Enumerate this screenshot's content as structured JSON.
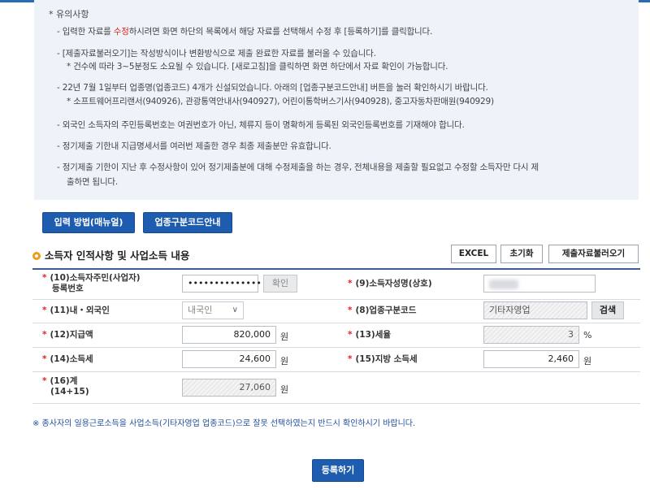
{
  "notice": {
    "title": "* 유의사항",
    "lines": [
      {
        "pre": "- 입력한 자료를 ",
        "red": "수정",
        "post": "하시려면 화면 하단의 목록에서 해당 자료를 선택해서 수정 후 [등록하기]를 클릭합니다."
      },
      {
        "text": "- [제출자료불러오기]는 작성방식이나 변환방식으로 제출 완료한 자료를 불러올 수 있습니다."
      },
      {
        "text": "* 건수에 따라 3~5분정도 소요될 수 있습니다. [새로고침]을 클릭하면 화면 하단에서 자료 확인이 가능합니다."
      },
      {
        "text": "- 22년 7월 1일부터 업종명(업종코드) 4개가 신설되었습니다. 아래의 [업종구분코드안내] 버튼을 눌러 확인하시기 바랍니다."
      },
      {
        "text": "* 소프트웨어프리랜서(940926), 관광통역안내사(940927), 어린이통학버스기사(940928), 중고자동차판매원(940929)"
      },
      {
        "text": "- 외국인 소득자의 주민등록번호는 여권번호가 아닌, 체류지 등이 명확하게 등록된 외국인등록번호를 기재해야 합니다."
      },
      {
        "text": "- 정기제출 기한내 지급명세서를 여러번 제출한 경우 최종 제출분만 유효합니다."
      },
      {
        "text": "- 정기제출 기한이 지난 후 수정사항이 있어 정기제출분에 대해 수정제출을 하는 경우, 전체내용을 제출할 필요없고 수정할 소득자만 다시 제"
      },
      {
        "text": "출하면 됩니다."
      }
    ]
  },
  "buttons": {
    "manual": "입력 방법(매뉴얼)",
    "industry_guide": "업종구분코드안내",
    "excel": "EXCEL",
    "reset": "초기화",
    "load": "제출자료불러오기",
    "confirm": "확인",
    "search": "검색",
    "register": "등록하기"
  },
  "section": {
    "title": "소득자 인적사항 및 사업소득 내용"
  },
  "form": {
    "f10_label_1": "(10)소득자주민(사업자)",
    "f10_label_2": "등록번호",
    "f10_value": "••••••••••••••",
    "f9_label": "(9)소득자성명(상호)",
    "f11_label": "(11)내・외국인",
    "f11_value": "내국인",
    "f8_label": "(8)업종구분코드",
    "f8_value": "기타자영업",
    "f12_label": "(12)지급액",
    "f12_value": "820,000",
    "f13_label": "(13)세율",
    "f13_value": "3",
    "f14_label": "(14)소득세",
    "f14_value": "24,600",
    "f15_label": "(15)지방 소득세",
    "f15_value": "2,460",
    "f16_label_1": "(16)계",
    "f16_label_2": "(14+15)",
    "f16_value": "27,060",
    "unit_won": "원",
    "unit_pct": "%",
    "star": "*"
  },
  "footnote": "※ 종사자의 일용근로소득을 사업소득(기타자영업 업종코드)으로 잘못 선택하였는지 반드시 확인하시기 바랍니다."
}
